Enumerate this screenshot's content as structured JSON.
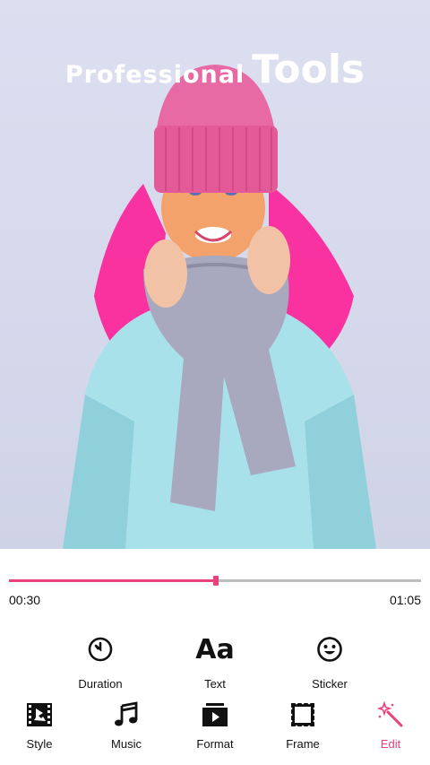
{
  "banner": {
    "title_small": "Professional",
    "title_big": "Tools"
  },
  "player": {
    "current_time": "00:30",
    "total_time": "01:05",
    "progress": 0.503
  },
  "tools": [
    {
      "label": "Duration",
      "icon": "timer-icon"
    },
    {
      "label": "Text",
      "icon": "text-aa-icon",
      "glyph": "Aa"
    },
    {
      "label": "Sticker",
      "icon": "smiley-icon"
    }
  ],
  "nav": [
    {
      "label": "Style",
      "icon": "film-strip-icon"
    },
    {
      "label": "Music",
      "icon": "music-note-icon"
    },
    {
      "label": "Format",
      "icon": "format-play-icon"
    },
    {
      "label": "Frame",
      "icon": "frame-icon"
    },
    {
      "label": "Edit",
      "icon": "magic-wand-icon",
      "active": true
    }
  ],
  "colors": {
    "accent": "#e8417e",
    "track": "#bdbdbd",
    "text": "#111111"
  }
}
